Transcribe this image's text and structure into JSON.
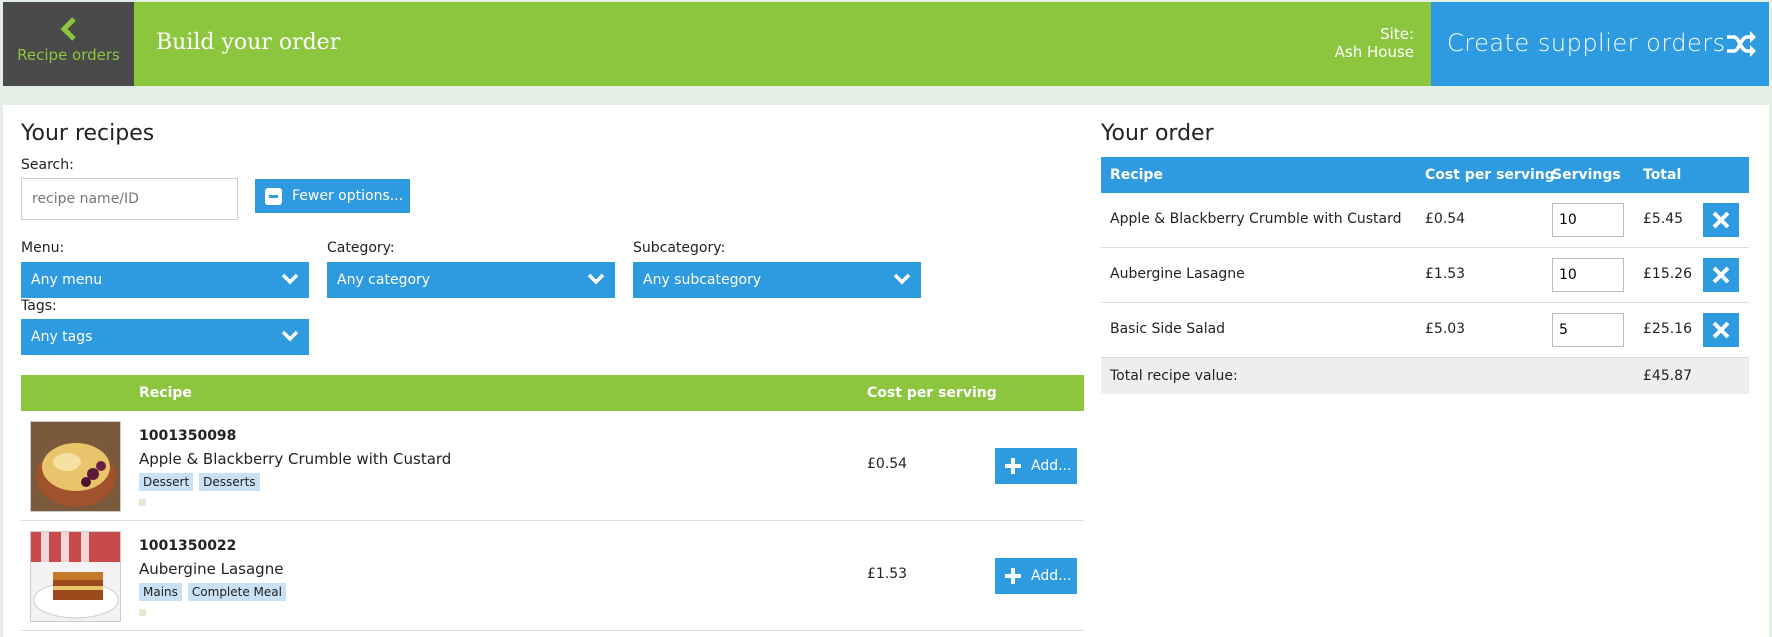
{
  "header": {
    "back_label": "Recipe orders",
    "title": "Build your order",
    "site_label": "Site:",
    "site_name": "Ash House",
    "create_label": "Create supplier orders"
  },
  "recipes": {
    "title": "Your recipes",
    "search_label": "Search:",
    "search_placeholder": "recipe name/ID",
    "fewer_options_label": "Fewer options...",
    "filters": {
      "menu_label": "Menu:",
      "menu_value": "Any menu",
      "category_label": "Category:",
      "category_value": "Any category",
      "subcategory_label": "Subcategory:",
      "subcategory_value": "Any subcategory",
      "tags_label": "Tags:",
      "tags_value": "Any tags"
    },
    "columns": {
      "recipe": "Recipe",
      "cost": "Cost per serving"
    },
    "add_label": "Add...",
    "rows": [
      {
        "id": "1001350098",
        "name": "Apple & Blackberry Crumble with Custard",
        "tags": [
          "Dessert",
          "Desserts"
        ],
        "cost": "£0.54"
      },
      {
        "id": "1001350022",
        "name": "Aubergine Lasagne",
        "tags": [
          "Mains",
          "Complete Meal"
        ],
        "cost": "£1.53"
      }
    ]
  },
  "order": {
    "title": "Your order",
    "columns": {
      "recipe": "Recipe",
      "cost": "Cost per serving",
      "servings": "Servings",
      "total": "Total"
    },
    "rows": [
      {
        "name": "Apple & Blackberry Crumble with Custard",
        "cost": "£0.54",
        "servings": "10",
        "total": "£5.45"
      },
      {
        "name": "Aubergine Lasagne",
        "cost": "£1.53",
        "servings": "10",
        "total": "£15.26"
      },
      {
        "name": "Basic Side Salad",
        "cost": "£5.03",
        "servings": "5",
        "total": "£25.16"
      }
    ],
    "total_label": "Total recipe value:",
    "total_value": "£45.87"
  },
  "colors": {
    "green": "#8cc63f",
    "blue": "#2e9ae0",
    "dark": "#4a4a4a"
  },
  "icons": {
    "back": "chevron-left-icon",
    "create": "shuffle-icon",
    "dropdown": "chevron-down-icon",
    "add": "plus-icon",
    "remove": "close-icon",
    "fewer": "minus-icon"
  }
}
